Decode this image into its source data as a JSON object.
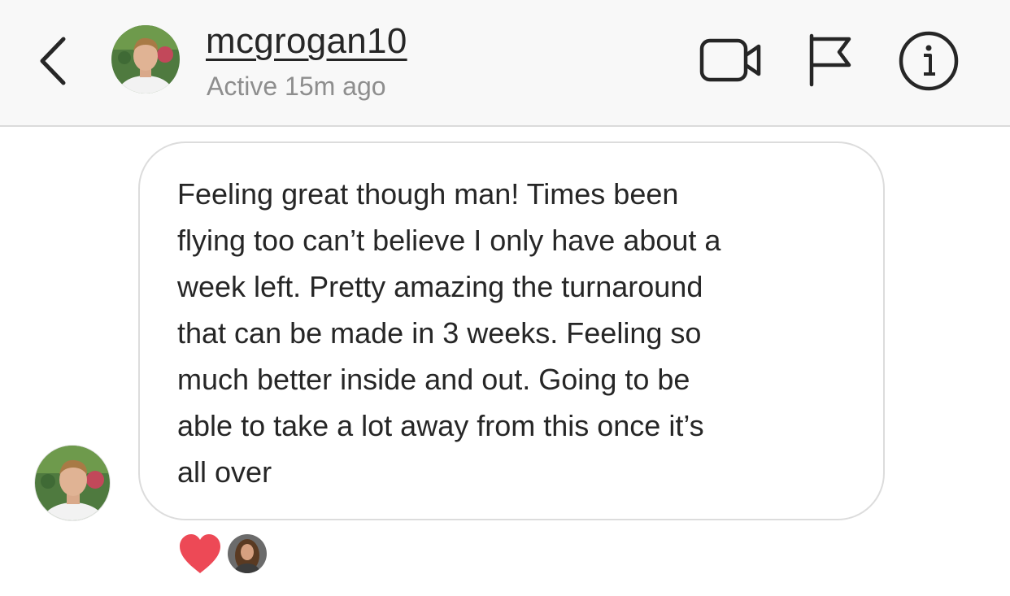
{
  "header": {
    "username": "mcgrogan10",
    "status": "Active 15m ago",
    "icons": {
      "back": "chevron-left-icon",
      "video": "video-camera-icon",
      "flag": "flag-icon",
      "info": "info-icon"
    }
  },
  "messages": [
    {
      "sender": "mcgrogan10",
      "text": "Feeling great though man! Times been\nflying too can’t believe I only have about a\nweek left. Pretty amazing the turnaround\nthat can be made in 3 weeks. Feeling so\nmuch better inside and out. Going to be\nable to take a lot away from this once it’s\nall over",
      "reaction": "heart-icon"
    }
  ],
  "colors": {
    "header_bg": "#f8f8f8",
    "text": "#262626",
    "muted": "#8e8e8e",
    "heart": "#ed4956",
    "bubble_border": "#dcdcdc"
  }
}
